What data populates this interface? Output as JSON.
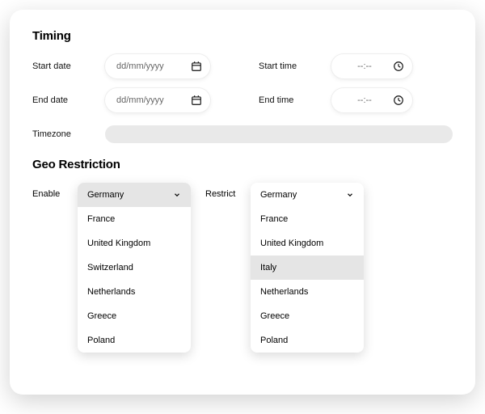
{
  "timing": {
    "heading": "Timing",
    "start_date_label": "Start date",
    "end_date_label": "End date",
    "start_time_label": "Start time",
    "end_time_label": "End time",
    "date_placeholder": "dd/mm/yyyy",
    "time_placeholder": "--:--",
    "timezone_label": "Timezone"
  },
  "geo": {
    "heading": "Geo Restriction",
    "enable_label": "Enable",
    "restrict_label": "Restrict",
    "enable_options": [
      "Germany",
      "France",
      "United Kingdom",
      "Switzerland",
      "Netherlands",
      "Greece",
      "Poland"
    ],
    "enable_selected": "Germany",
    "restrict_options": [
      "Germany",
      "France",
      "United Kingdom",
      "Italy",
      "Netherlands",
      "Greece",
      "Poland"
    ],
    "restrict_selected": "Italy"
  }
}
